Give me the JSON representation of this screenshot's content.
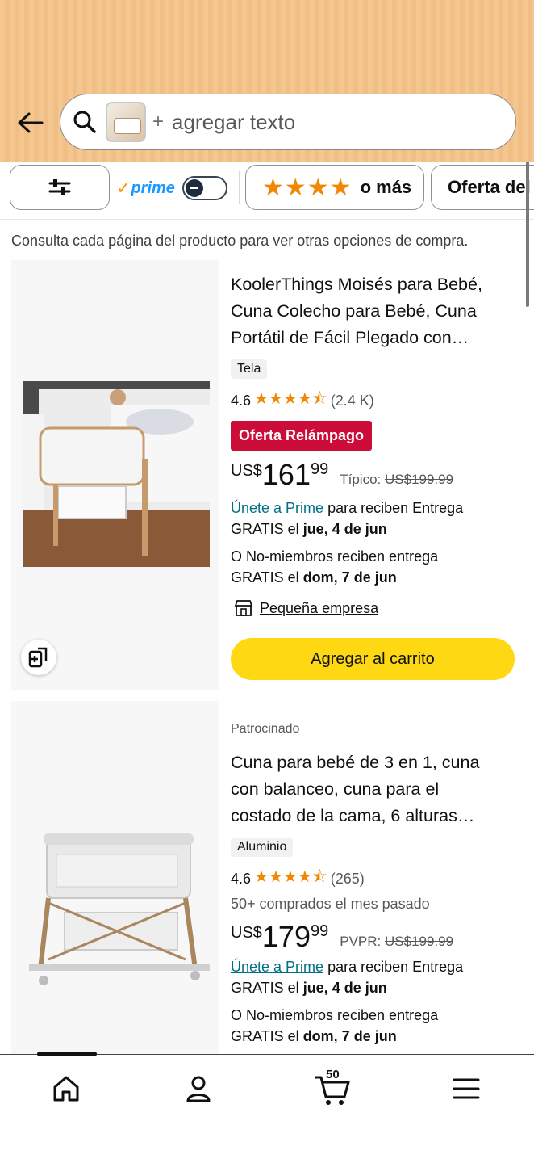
{
  "search": {
    "plus": "+",
    "placeholder": "agregar texto"
  },
  "filters": {
    "prime_check": "✓",
    "prime_label": "prime",
    "prime_toggle_on": false,
    "stars_glyphs": "★★★★",
    "stars_label": "o más",
    "offer_label": "Oferta del"
  },
  "notice": "Consulta cada página del producto para ver otras opciones de compra.",
  "products": [
    {
      "sponsored": "",
      "title_lines": [
        "KoolerThings Moisés para Bebé,",
        "Cuna Colecho para Bebé, Cuna",
        "Portátil de Fácil Plegado con…"
      ],
      "material": "Tela",
      "rating": "4.6",
      "stars": "★★★★⯪",
      "reviews": "(2.4 K)",
      "deal": "Oferta Relámpago",
      "price_currency": "US$",
      "price_whole": "161",
      "price_fraction": "99",
      "compare_label": "Típico:",
      "compare_price": "US$199.99",
      "prime_link": "Únete a Prime",
      "prime_text": " para reciben Entrega",
      "prime_free": "GRATIS el ",
      "prime_date": "jue, 4 de jun",
      "nonmember_text": "O No-miembros reciben entrega",
      "nonmember_free": "GRATIS el ",
      "nonmember_date": "dom, 7 de jun",
      "small_business": "Pequeña empresa",
      "add_to_cart": "Agregar al carrito"
    },
    {
      "sponsored": "Patrocinado",
      "title_lines": [
        "Cuna para bebé de 3 en 1, cuna",
        "con balanceo, cuna para el",
        "costado de la cama, 6 alturas…"
      ],
      "material": "Aluminio",
      "rating": "4.6",
      "stars": "★★★★⯪",
      "reviews": "(265)",
      "bought": "50+ comprados el mes pasado",
      "price_currency": "US$",
      "price_whole": "179",
      "price_fraction": "99",
      "compare_label": "PVPR:",
      "compare_price": "US$199.99",
      "prime_link": "Únete a Prime",
      "prime_text": " para reciben Entrega",
      "prime_free": "GRATIS el ",
      "prime_date": "jue, 4 de jun",
      "nonmember_text": "O No-miembros reciben entrega",
      "nonmember_free": "GRATIS el ",
      "nonmember_date": "dom, 7 de jun"
    }
  ],
  "bottom_nav": {
    "cart_count": "50",
    "items": [
      "home-icon",
      "account-icon",
      "cart-icon",
      "menu-icon"
    ]
  },
  "colors": {
    "header_bg": "#f4c690",
    "deal_red": "#cc0c39",
    "cart_yellow": "#ffd814",
    "star_orange": "#f08804",
    "link_teal": "#007185",
    "prime_blue": "#1a98ff"
  }
}
